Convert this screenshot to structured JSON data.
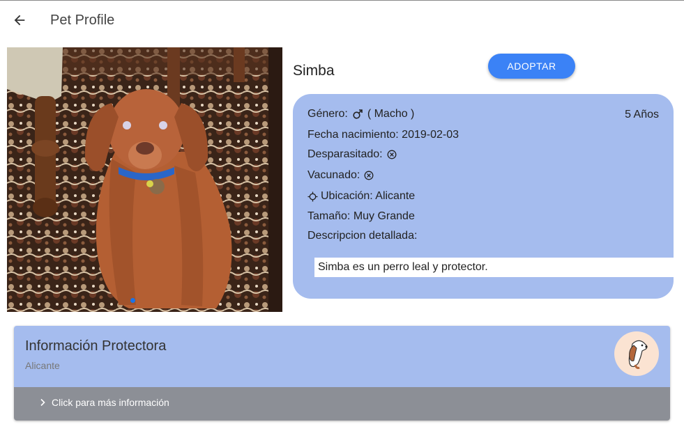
{
  "header": {
    "title": "Pet Profile",
    "back_icon": "arrow-left-icon"
  },
  "pet": {
    "name": "Simba",
    "adopt_label": "ADOPTAR",
    "age": "5 Años",
    "gender_label": "Género:",
    "gender_value": "( Macho )",
    "birth_label": "Fecha nacimiento: 2019-02-03",
    "dewormed_label": "Desparasitado:",
    "vaccinated_label": "Vacunado:",
    "location_label": "Ubicación: Alicante",
    "size_label": "Tamaño: Muy Grande",
    "description_label": "Descripcion detallada:",
    "description": "Simba es un perro leal y protector."
  },
  "protector": {
    "title": "Información Protectora",
    "subtitle": "Alicante",
    "more_label": "Click para más información"
  },
  "colors": {
    "accent": "#3b82f6",
    "card": "#a5bcee",
    "footer": "#8c8f96"
  }
}
